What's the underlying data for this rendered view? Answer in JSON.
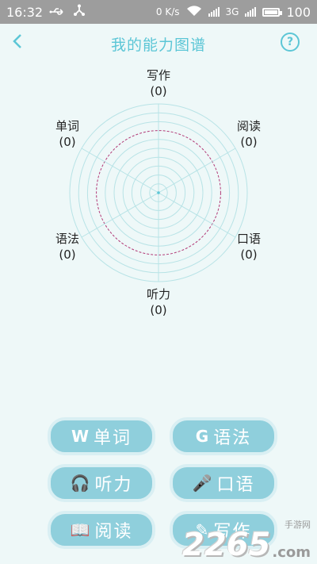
{
  "status": {
    "time": "16:32",
    "net_speed": "0 K/s",
    "signal_type": "3G",
    "battery": "100",
    "icons": [
      "usb-icon",
      "share-icon",
      "wifi-icon",
      "signal-icon",
      "battery-icon"
    ]
  },
  "header": {
    "title": "我的能力图谱",
    "back_icon": "chevron-left-icon",
    "help_icon": "question-circle-icon"
  },
  "chart_data": {
    "type": "radar",
    "axes": [
      "写作",
      "阅读",
      "口语",
      "听力",
      "语法",
      "单词"
    ],
    "values": [
      0,
      0,
      0,
      0,
      0,
      0
    ],
    "value_labels": [
      "(0)",
      "(0)",
      "(0)",
      "(0)",
      "(0)",
      "(0)"
    ],
    "rings": 10,
    "colors": {
      "grid": "#b8e3e6",
      "highlight_ring": "#b23b78"
    }
  },
  "buttons": [
    {
      "label": "单词",
      "icon": "W",
      "icon_name": "word-icon"
    },
    {
      "label": "语法",
      "icon": "G",
      "icon_name": "grammar-icon"
    },
    {
      "label": "听力",
      "icon": "🎧",
      "icon_name": "headphones-icon"
    },
    {
      "label": "口语",
      "icon": "🎤",
      "icon_name": "microphone-icon"
    },
    {
      "label": "阅读",
      "icon": "📖",
      "icon_name": "book-icon"
    },
    {
      "label": "写作",
      "icon": "✎",
      "icon_name": "write-icon"
    }
  ],
  "watermark": {
    "number": "2265",
    "suffix": ".com",
    "text": "手游网"
  },
  "colors": {
    "accent": "#5cc6d6",
    "button": "#8fcfdc",
    "background": "#eef8f8"
  }
}
